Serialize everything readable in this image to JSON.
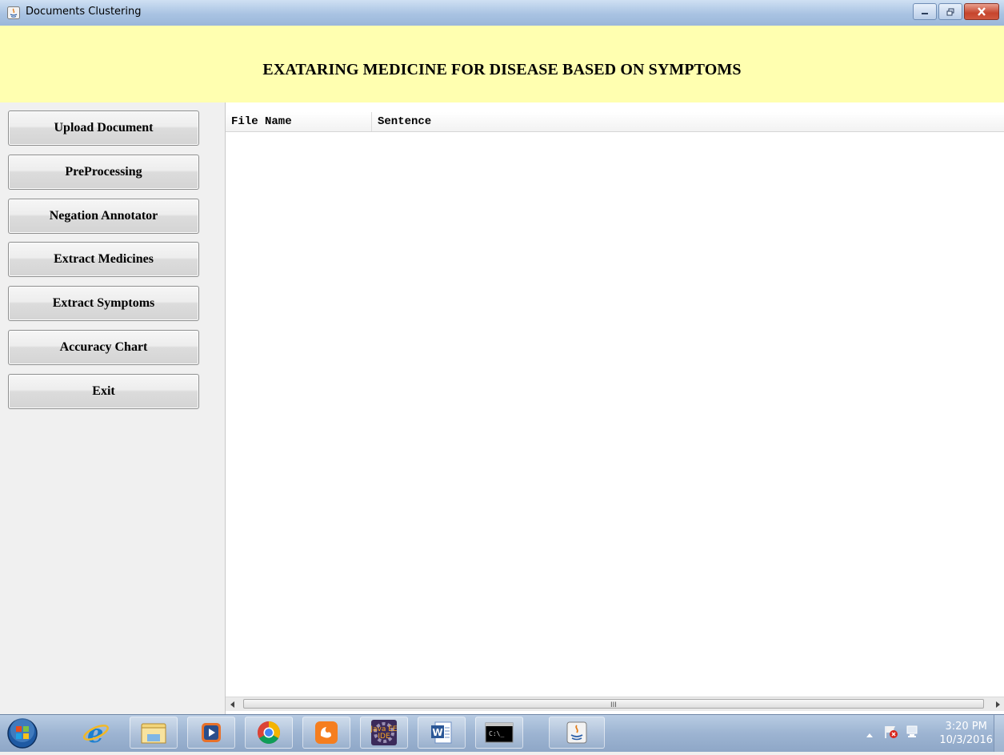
{
  "window": {
    "title": "Documents Clustering",
    "icon": "java-icon",
    "controls": [
      "minimize",
      "maximize",
      "close"
    ]
  },
  "banner": {
    "title": "EXATARING MEDICINE FOR DISEASE BASED ON SYMPTOMS",
    "background": "#ffffb0"
  },
  "sidebar": {
    "buttons": [
      {
        "label": "Upload Document"
      },
      {
        "label": "PreProcessing"
      },
      {
        "label": "Negation Annotator"
      },
      {
        "label": "Extract Medicines"
      },
      {
        "label": "Extract Symptoms"
      },
      {
        "label": "Accuracy Chart"
      },
      {
        "label": "Exit"
      }
    ]
  },
  "table": {
    "columns": [
      "File Name",
      "Sentence"
    ],
    "rows": [],
    "scroll_grip": "III"
  },
  "taskbar": {
    "items": [
      "start-orb-icon",
      "internet-explorer-icon",
      "file-explorer-icon",
      "media-player-icon",
      "chrome-icon",
      "uc-browser-icon",
      "java-ee-ide-icon",
      "word-icon",
      "command-prompt-icon",
      "java-icon"
    ],
    "clock": {
      "time": "3:20 PM",
      "date": "10/3/2016"
    }
  }
}
